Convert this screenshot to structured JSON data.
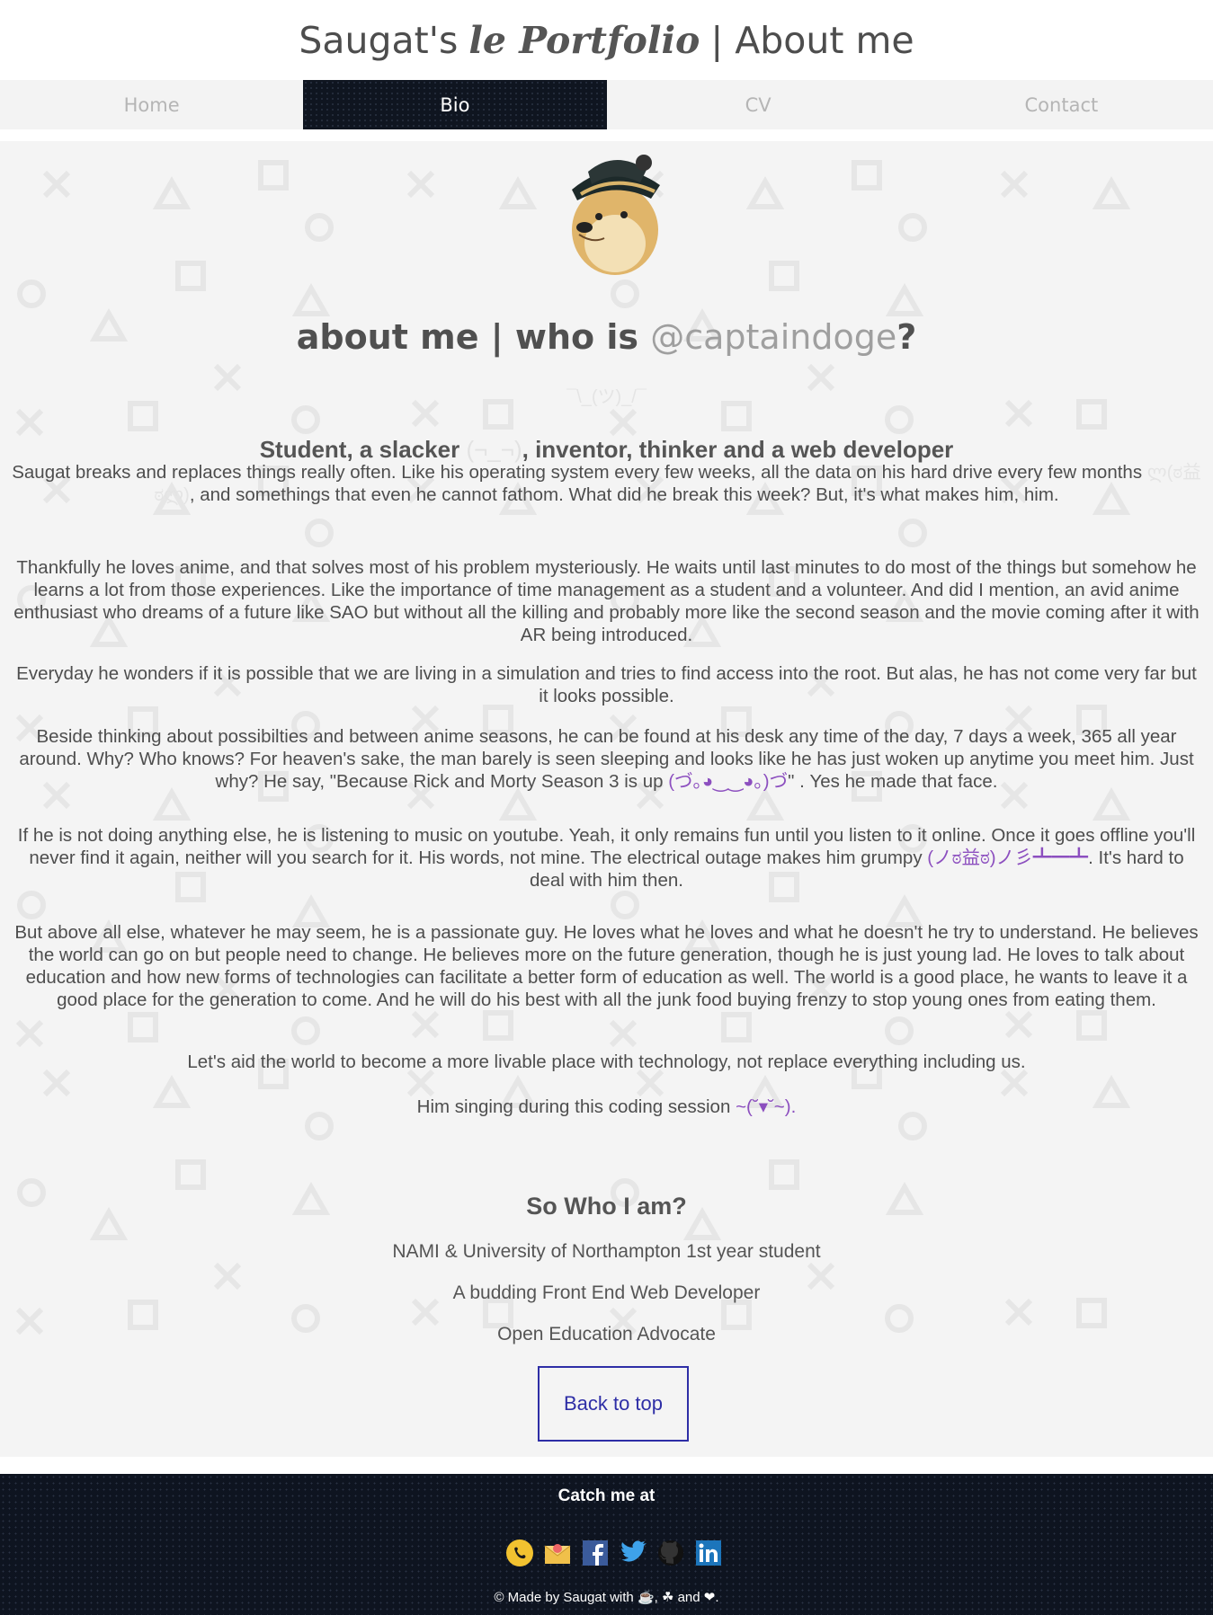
{
  "header": {
    "title_prefix": "Saugat's",
    "title_script": "le Portfolio",
    "title_suffix": "| About me"
  },
  "nav": {
    "items": [
      {
        "label": "Home"
      },
      {
        "label": "Bio"
      },
      {
        "label": "CV"
      },
      {
        "label": "Contact"
      }
    ],
    "active": "Bio"
  },
  "about": {
    "heading": "about me | who is",
    "handle": "@captaindoge",
    "question_mark": "?",
    "shrug": "¯\\_(ツ)_/¯",
    "tagline_before": "Student, a slacker",
    "tagline_ghost": "(¬_¬)",
    "tagline_after": ", inventor, thinker and a web developer"
  },
  "paragraphs": {
    "p1_before": "Saugat breaks and replaces things really often. Like his operating system every few weeks, all the data on his hard drive every few months",
    "p1_kao": "ლ(ಠ益ಠლ)",
    "p1_after": ", and somethings that even he cannot fathom. What did he break this week? But, it's what makes him, him.",
    "p2": "Thankfully he loves anime, and that solves most of his problem mysteriously. He waits until last minutes to do most of the things but somehow he learns a lot from those experiences. Like the importance of time management as a student and a volunteer. And did I mention, an avid anime enthusiast who dreams of a future like SAO but without all the killing and probably more like the second season and the movie coming after it with AR being introduced.",
    "p3": "Everyday he wonders if it is possible that we are living in a simulation and tries to find access into the root. But alas, he has not come very far but it looks possible.",
    "p4_before": "Beside thinking about possibilties and between anime seasons, he can be found at his desk any time of the day, 7 days a week, 365 all year around. Why? Who knows? For heaven's sake, the man barely is seen sleeping and looks like he has just woken up anytime you meet him. Just why? He say, \"Because Rick and Morty Season 3 is up",
    "p4_kao": "(づ｡◕‿‿◕｡)づ",
    "p4_after": "\" . Yes he made that face.",
    "p5_before": "If he is not doing anything else, he is listening to music on youtube. Yeah, it only remains fun until you listen to it online. Once it goes offline you'll never find it again, neither will you search for it. His words, not mine. The electrical outage makes him grumpy",
    "p5_kao": "(ノಠ益ಠ)ノ彡┻━┻",
    "p5_after": ". It's hard to deal with him then.",
    "p6": "But above all else, whatever he may seem, he is a passionate guy. He loves what he loves and what he doesn't he try to understand. He believes the world can go on but people need to change. He believes more on the future generation, though he is just young lad. He loves to talk about education and how new forms of technologies can facilitate a better form of education as well. The world is a good place, he wants to leave it a good place for the generation to come. And he will do his best with all the junk food buying frenzy to stop young ones from eating them.",
    "p7": "Let's aid the world to become a more livable place with technology, not replace everything including us.",
    "p8_before": "Him singing during this coding session",
    "p8_kao": "~(˘▾˘~)."
  },
  "who": {
    "heading": "So Who I am?",
    "facts": [
      "NAMI & University of Northampton 1st year student",
      "A budding Front End Web Developer",
      "Open Education Advocate"
    ],
    "back_to_top": "Back to top"
  },
  "footer": {
    "catch": "Catch me at",
    "icons": [
      "whatsapp-icon",
      "email-icon",
      "facebook-icon",
      "twitter-icon",
      "github-icon",
      "linkedin-icon"
    ],
    "credit_prefix": "© Made by Saugat with",
    "credit_mid": ",",
    "credit_and": "and",
    "credit_end": "."
  },
  "colors": {
    "accent": "#2e2ea6",
    "kaomoji": "#8c4fbf",
    "dark_bg": "#0e1420",
    "main_bg": "#f4f4f4"
  }
}
